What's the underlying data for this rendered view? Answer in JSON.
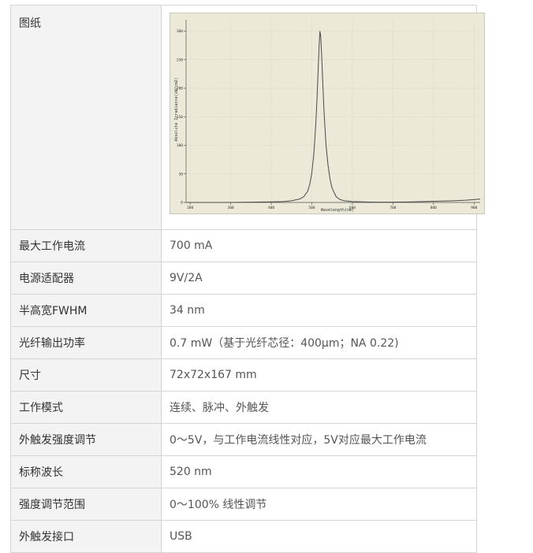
{
  "rows": [
    {
      "label": "图纸"
    },
    {
      "label": "最大工作电流",
      "value": "700 mA"
    },
    {
      "label": "电源适配器",
      "value": "9V/2A"
    },
    {
      "label": "半高宽FWHM",
      "value": "34 nm"
    },
    {
      "label": "光纤输出功率",
      "value": "0.7 mW（基于光纤芯径：400μm；NA 0.22)"
    },
    {
      "label": "尺寸",
      "value": "72x72x167 mm"
    },
    {
      "label": "工作模式",
      "value": "连续、脉冲、外触发"
    },
    {
      "label": "外触发强度调节",
      "value": "0～5V，与工作电流线性对应，5V对应最大工作电流"
    },
    {
      "label": "标称波长",
      "value": "520 nm"
    },
    {
      "label": "强度调节范围",
      "value": "0～100% 线性调节"
    },
    {
      "label": "外触发接口",
      "value": "USB"
    }
  ],
  "chart_data": {
    "type": "line",
    "xlabel": "Wavelength(nm)",
    "ylabel": "Absolute Irradiance(uW/cm2)",
    "x_ticks": [
      "200",
      "300",
      "400",
      "500",
      "600",
      "700",
      "800",
      "900"
    ],
    "y_ticks": [
      "0",
      "50",
      "100",
      "150",
      "200",
      "250",
      "300"
    ],
    "xlim": [
      190,
      915
    ],
    "ylim": [
      0,
      320
    ],
    "grid": true,
    "series": [
      {
        "x": [
          190,
          250,
          300,
          350,
          400,
          430,
          450,
          470,
          480,
          490,
          495,
          500,
          505,
          510,
          513,
          516,
          518,
          520,
          522,
          524,
          527,
          530,
          535,
          540,
          545,
          550,
          560,
          570,
          580,
          600,
          650,
          700,
          750,
          800,
          850,
          880,
          900,
          915
        ],
        "y": [
          0,
          0,
          0,
          0.5,
          1,
          1.5,
          3,
          6,
          10,
          20,
          32,
          52,
          85,
          140,
          185,
          240,
          275,
          300,
          290,
          260,
          210,
          160,
          100,
          65,
          40,
          25,
          10,
          5,
          3,
          1.5,
          0.5,
          0.5,
          1,
          2,
          3,
          4,
          5,
          6
        ]
      }
    ],
    "line_color": "#4a4a4a"
  }
}
